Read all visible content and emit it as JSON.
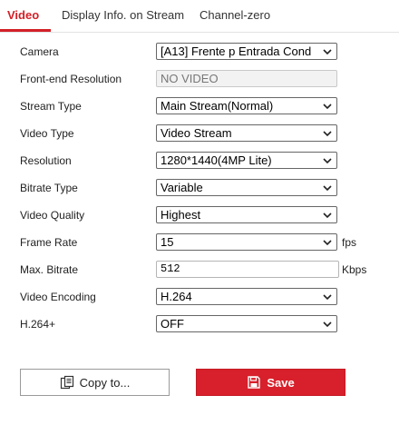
{
  "tabs": [
    {
      "label": "Video",
      "active": true
    },
    {
      "label": "Display Info. on Stream",
      "active": false
    },
    {
      "label": "Channel-zero",
      "active": false
    }
  ],
  "form": {
    "camera": {
      "label": "Camera",
      "value": "[A13] Frente p Entrada Cond"
    },
    "front_end_resolution": {
      "label": "Front-end Resolution",
      "value": "NO VIDEO"
    },
    "stream_type": {
      "label": "Stream Type",
      "value": "Main Stream(Normal)"
    },
    "video_type": {
      "label": "Video Type",
      "value": "Video Stream"
    },
    "resolution": {
      "label": "Resolution",
      "value": "1280*1440(4MP Lite)"
    },
    "bitrate_type": {
      "label": "Bitrate Type",
      "value": "Variable"
    },
    "video_quality": {
      "label": "Video Quality",
      "value": "Highest"
    },
    "frame_rate": {
      "label": "Frame Rate",
      "value": "15",
      "unit": "fps"
    },
    "max_bitrate": {
      "label": "Max. Bitrate",
      "value": "512",
      "unit": "Kbps"
    },
    "video_encoding": {
      "label": "Video Encoding",
      "value": "H.264"
    },
    "h264_plus": {
      "label": "H.264+",
      "value": "OFF"
    }
  },
  "buttons": {
    "copy_label": "Copy to...",
    "save_label": "Save"
  },
  "colors": {
    "accent": "#d32027",
    "save_bg": "#d7202b"
  },
  "icons": {
    "copy": "copy-icon",
    "save": "save-icon",
    "select": "chevron-down-icon"
  }
}
